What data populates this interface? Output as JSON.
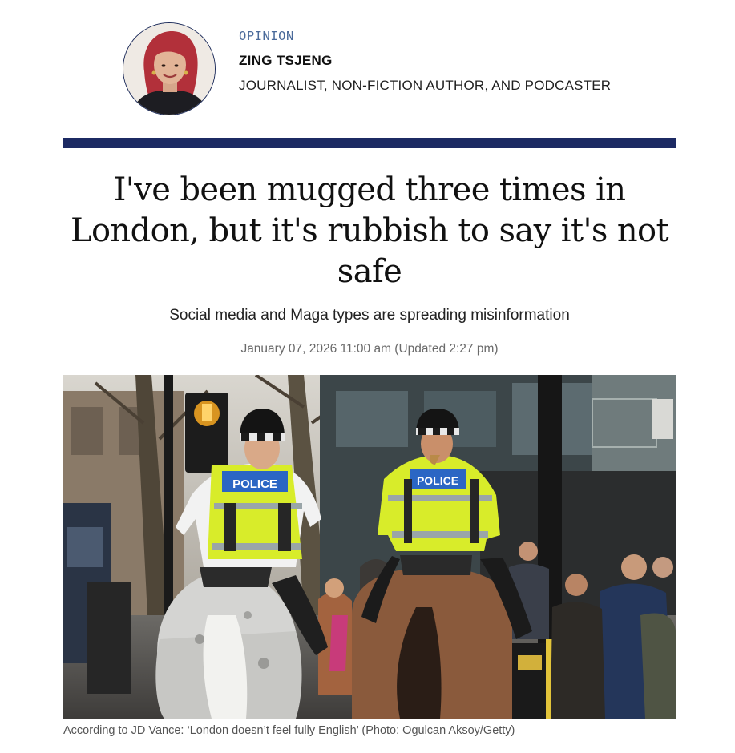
{
  "author": {
    "section": "OPINION",
    "name": "ZING TSJENG",
    "role": "JOURNALIST, NON-FICTION AUTHOR, AND PODCASTER"
  },
  "article": {
    "headline_lines": [
      "I've been mugged three times in",
      "London, but it's rubbish to say it's not",
      "safe"
    ],
    "standfirst": "Social media and Maga types are spreading misinformation",
    "dateline": "January 07, 2026 11:00 am (Updated 2:27 pm)"
  },
  "image": {
    "vest_text": "POLICE",
    "caption": "According to JD Vance: ‘London doesn’t feel fully English’ (Photo: Ogulcan Aksoy/Getty)"
  },
  "colors": {
    "divider": "#1c2a63",
    "kicker": "#4a6a9a",
    "hi_vis": "#d8ec2a"
  }
}
